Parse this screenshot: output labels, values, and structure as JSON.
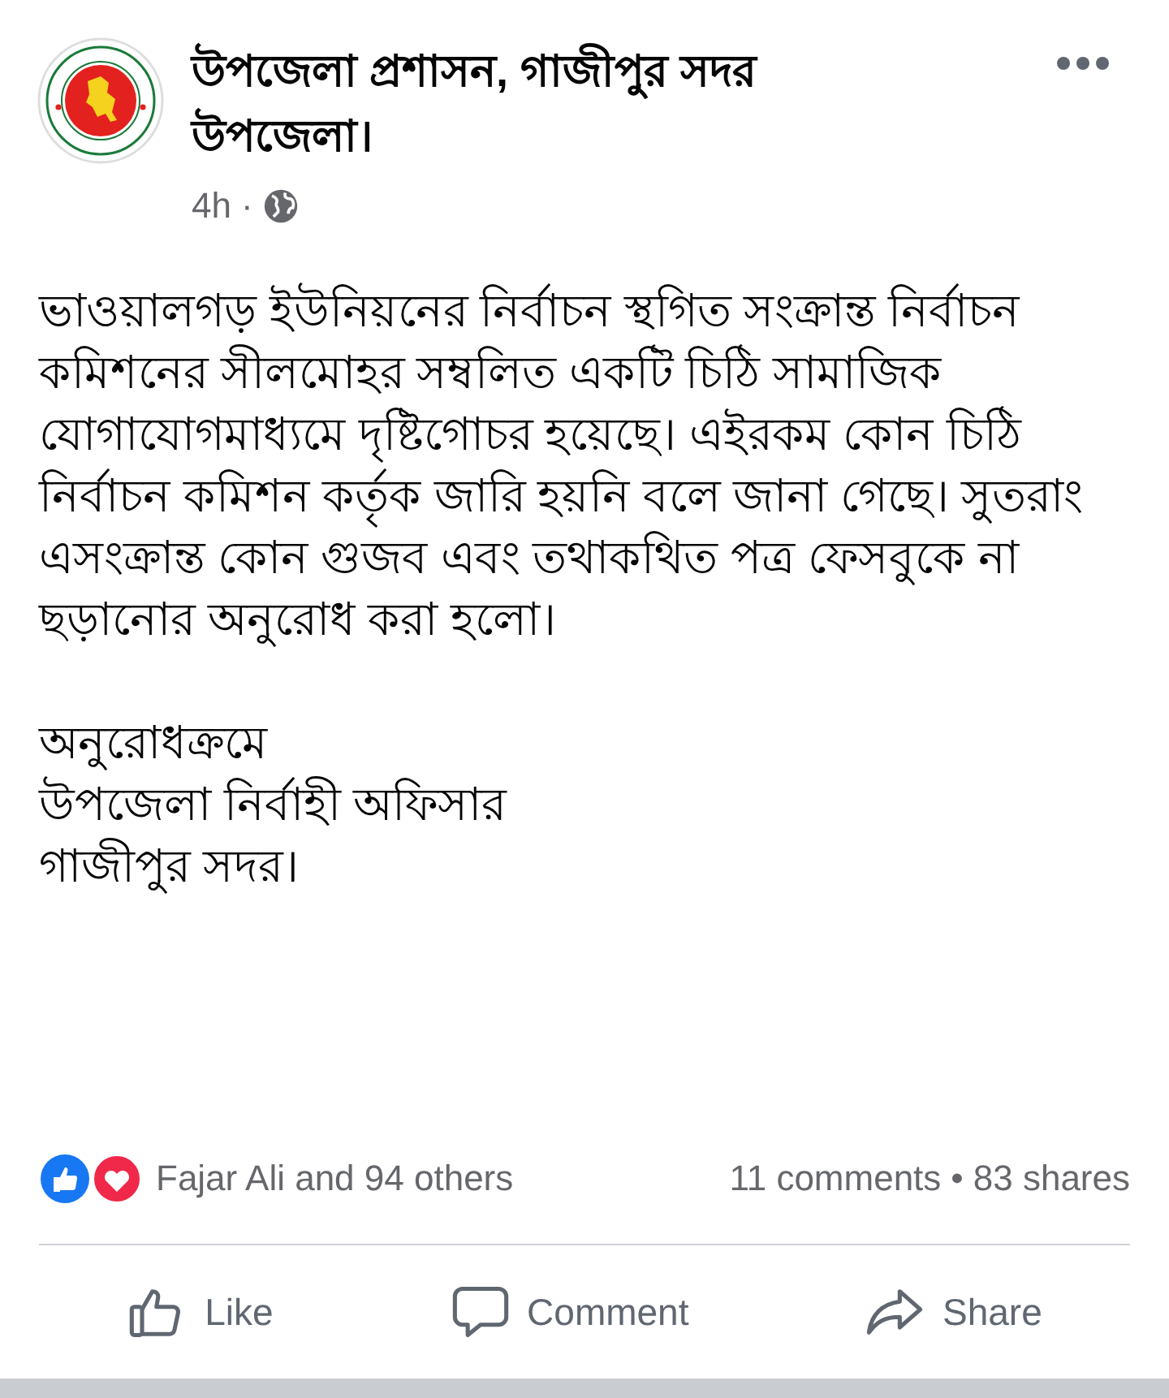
{
  "post": {
    "author": "উপজেলা প্রশাসন, গাজীপুর সদর উপজেলা।",
    "time": "4h",
    "separator": "·",
    "body": "ভাওয়ালগড় ইউনিয়নের নির্বাচন স্থগিত সংক্রান্ত নির্বাচন কমিশনের সীলমোহর সম্বলিত একটি চিঠি সামাজিক যোগাযোগমাধ্যমে দৃষ্টিগোচর হয়েছে। এইরকম কোন চিঠি নির্বাচন কমিশন কর্তৃক জারি হয়নি বলে জানা গেছে। সুতরাং এসংক্রান্ত কোন গুজব এবং তথাকথিত পত্র ফেসবুকে না ছড়ানোর অনুরোধ করা হলো।",
    "signature": [
      "অনুরোধক্রমে",
      "উপজেলা নির্বাহী অফিসার",
      "গাজীপুর সদর।"
    ]
  },
  "reactions": {
    "summary": "Fajar Ali and 94 others",
    "comments": "11 comments",
    "dot": "•",
    "shares": "83 shares"
  },
  "actions": [
    {
      "kind": "like",
      "label": "Like"
    },
    {
      "kind": "comment",
      "label": "Comment"
    },
    {
      "kind": "share",
      "label": "Share"
    }
  ]
}
